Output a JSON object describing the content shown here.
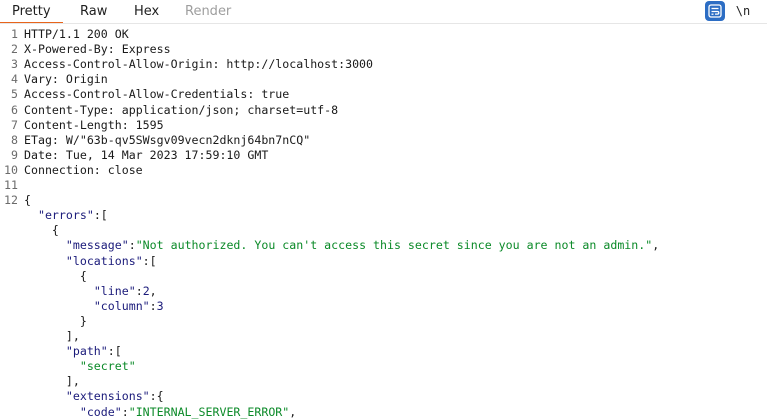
{
  "tabs": [
    {
      "label": "Pretty",
      "active": true
    },
    {
      "label": "Raw",
      "active": false
    },
    {
      "label": "Hex",
      "active": false
    },
    {
      "label": "Render",
      "active": false,
      "disabled": true
    }
  ],
  "toolbar": {
    "wrap_icon": "text-wrap-icon",
    "newline_label": "\\n"
  },
  "colors": {
    "accent": "#e8641b",
    "active_button": "#2c6dc4",
    "json_string": "#0b8a28",
    "json_key": "#1a1a7a"
  },
  "headers": [
    {
      "n": "1",
      "text": "HTTP/1.1 200 OK"
    },
    {
      "n": "2",
      "name": "X-Powered-By:",
      "value": " Express"
    },
    {
      "n": "3",
      "name": "Access-Control-Allow-Origin:",
      "value": " http://localhost:3000"
    },
    {
      "n": "4",
      "name": "Vary:",
      "value": " Origin"
    },
    {
      "n": "5",
      "name": "Access-Control-Allow-Credentials:",
      "value": " true"
    },
    {
      "n": "6",
      "name": "Content-Type:",
      "value": " application/json; charset=utf-8"
    },
    {
      "n": "7",
      "name": "Content-Length:",
      "value": " 1595"
    },
    {
      "n": "8",
      "name": "ETag:",
      "value": " W/\"63b-qv5SWsgv09vecn2dknj64bn7nCQ\""
    },
    {
      "n": "9",
      "name": "Date:",
      "value": " Tue, 14 Mar 2023 17:59:10 GMT"
    },
    {
      "n": "10",
      "name": "Connection:",
      "value": " close"
    },
    {
      "n": "11",
      "text": ""
    },
    {
      "n": "12",
      "text": "{"
    }
  ],
  "body": [
    [
      {
        "t": "p",
        "v": "  "
      },
      {
        "t": "k",
        "v": "\"errors\""
      },
      {
        "t": "p",
        "v": ":["
      }
    ],
    [
      {
        "t": "p",
        "v": "    {"
      }
    ],
    [
      {
        "t": "p",
        "v": "      "
      },
      {
        "t": "k",
        "v": "\"message\""
      },
      {
        "t": "p",
        "v": ":"
      },
      {
        "t": "s",
        "v": "\"Not authorized. You can't access this secret since you are not an admin.\""
      },
      {
        "t": "p",
        "v": ","
      }
    ],
    [
      {
        "t": "p",
        "v": "      "
      },
      {
        "t": "k",
        "v": "\"locations\""
      },
      {
        "t": "p",
        "v": ":["
      }
    ],
    [
      {
        "t": "p",
        "v": "        {"
      }
    ],
    [
      {
        "t": "p",
        "v": "          "
      },
      {
        "t": "k",
        "v": "\"line\""
      },
      {
        "t": "p",
        "v": ":"
      },
      {
        "t": "n",
        "v": "2"
      },
      {
        "t": "p",
        "v": ","
      }
    ],
    [
      {
        "t": "p",
        "v": "          "
      },
      {
        "t": "k",
        "v": "\"column\""
      },
      {
        "t": "p",
        "v": ":"
      },
      {
        "t": "n",
        "v": "3"
      }
    ],
    [
      {
        "t": "p",
        "v": "        }"
      }
    ],
    [
      {
        "t": "p",
        "v": "      ],"
      }
    ],
    [
      {
        "t": "p",
        "v": "      "
      },
      {
        "t": "k",
        "v": "\"path\""
      },
      {
        "t": "p",
        "v": ":["
      }
    ],
    [
      {
        "t": "p",
        "v": "        "
      },
      {
        "t": "s",
        "v": "\"secret\""
      }
    ],
    [
      {
        "t": "p",
        "v": "      ],"
      }
    ],
    [
      {
        "t": "p",
        "v": "      "
      },
      {
        "t": "k",
        "v": "\"extensions\""
      },
      {
        "t": "p",
        "v": ":{"
      }
    ],
    [
      {
        "t": "p",
        "v": "        "
      },
      {
        "t": "k",
        "v": "\"code\""
      },
      {
        "t": "p",
        "v": ":"
      },
      {
        "t": "s",
        "v": "\"INTERNAL_SERVER_ERROR\""
      },
      {
        "t": "p",
        "v": ","
      }
    ]
  ]
}
